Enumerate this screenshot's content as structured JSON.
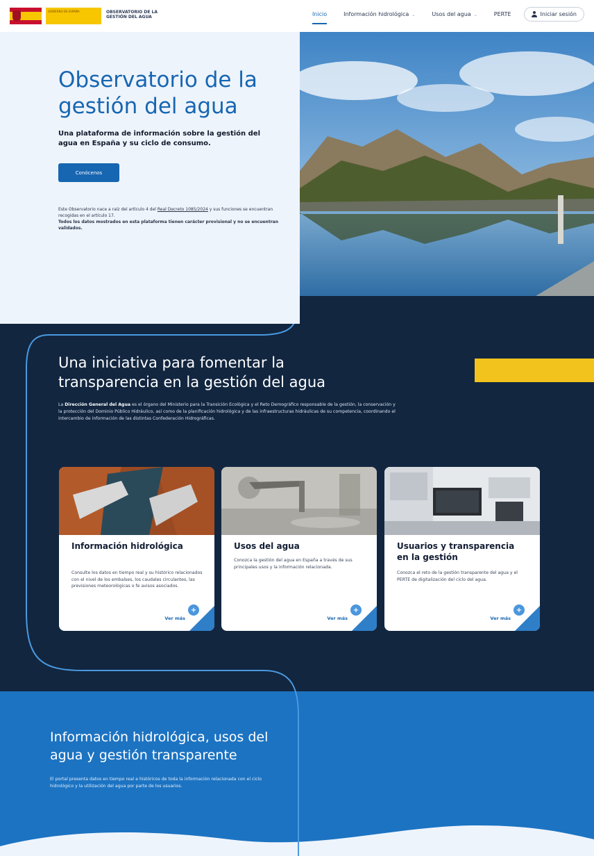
{
  "header": {
    "gov_label": "GOBIERNO DE ESPAÑA",
    "gov_ministry": "MINISTERIO PARA LA TRANSICIÓN ECOLÓGICA Y EL RETO DEMOGRÁFICO",
    "site_name": "OBSERVATORIO DE LA GESTIÓN DEL AGUA",
    "nav": [
      {
        "label": "Inicio",
        "active": true
      },
      {
        "label": "Información hidrológica",
        "dropdown": true
      },
      {
        "label": "Usos del agua",
        "dropdown": true
      },
      {
        "label": "PERTE"
      }
    ],
    "login_label": "Iniciar sesión"
  },
  "hero": {
    "title": "Observatorio de la gestión del agua",
    "subtitle": "Una plataforma de información sobre la gestión del agua en España y su ciclo de consumo.",
    "button_label": "Conócenos",
    "note_prefix": "Este Observatorio nace a raíz del artículo 4 del ",
    "note_link": "Real Decreto 1085/2024",
    "note_suffix": " y sus funciones se encuentran recogidas en el artículo 17.",
    "note_bold": "Todos los datos mostrados en esta plataforma tienen carácter provisional y no se encuentran validados."
  },
  "section_initiative": {
    "title": "Una iniciativa  para fomentar la transparencia en la gestión del agua",
    "text_bold": "Dirección General del Agua",
    "text_prefix": "La ",
    "text_suffix": " es el órgano del Ministerio para la Transición Ecológica y el Reto Demográfico responsable de la gestión, la conservación y la protección del Dominio Público Hidráulico, así como de la planificación hidrológica y de las infraestructuras hidráulicas de su competencia, coordinando el intercambio de información de las distintas Confederación Hidrográficas."
  },
  "cards": [
    {
      "title": "Información hidrológica",
      "text": "Consulte los datos en tiempo real y su histórico relacionados con el nivel de los embalses, los caudales circulantes, las previsiones meteorológicas o fe avisos asociados.",
      "more": "Ver más"
    },
    {
      "title": "Usos del agua",
      "text": "Conozca la gestión del agua en España a través de sus principales usos y la información relacionada.",
      "more": "Ver más"
    },
    {
      "title": "Usuarios y transparencia en la gestión",
      "text": "Conozca el reto de la gestión transparente del agua y el PERTE de digitalización del ciclo del agua.",
      "more": "Ver más"
    }
  ],
  "section_portal": {
    "title": "Información hidrológica, usos del agua y gestión transparente",
    "text": "El portal presenta datos en tiempo real e históricos de toda la información relacionada con el ciclo hidrológico y la utilización del agua por parte de los usuarios."
  },
  "colors": {
    "primary": "#1766b2",
    "dark_navy": "#122640",
    "accent_yellow": "#f2c31c",
    "hero_bg": "#eef4fb"
  }
}
